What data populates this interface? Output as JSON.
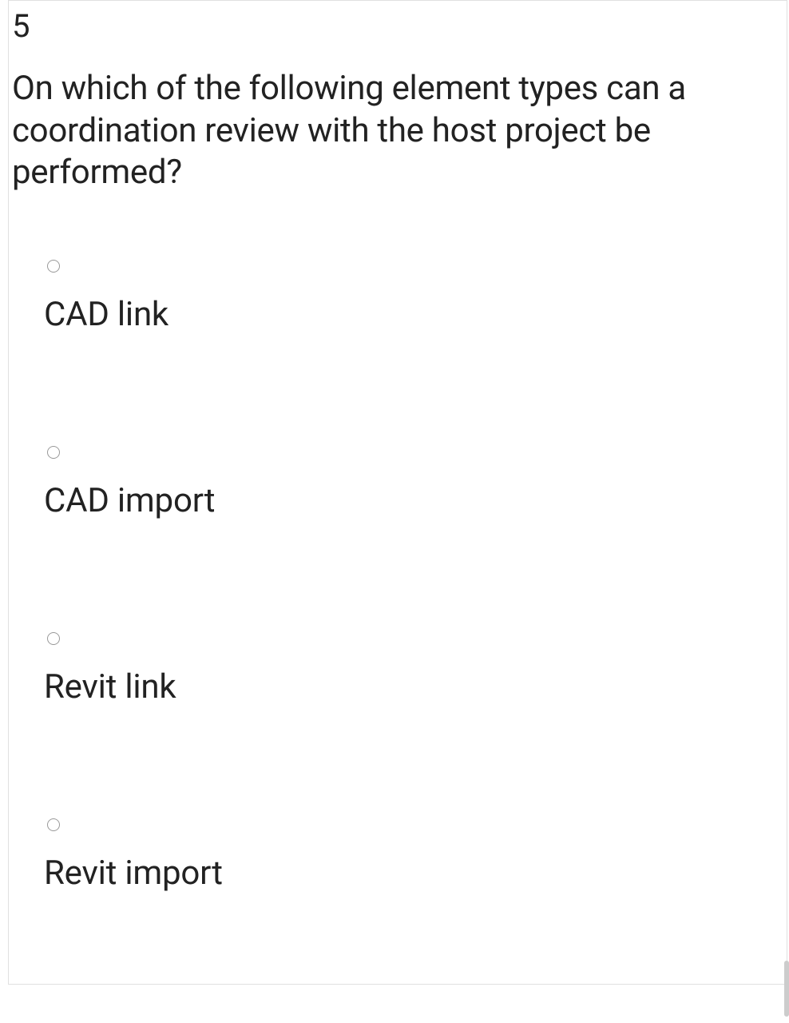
{
  "question": {
    "number": "5",
    "text": "On which of the following element types can a coordination review with the host project be performed?",
    "options": [
      {
        "label": "CAD link"
      },
      {
        "label": "CAD import"
      },
      {
        "label": "Revit link"
      },
      {
        "label": "Revit import"
      }
    ]
  }
}
